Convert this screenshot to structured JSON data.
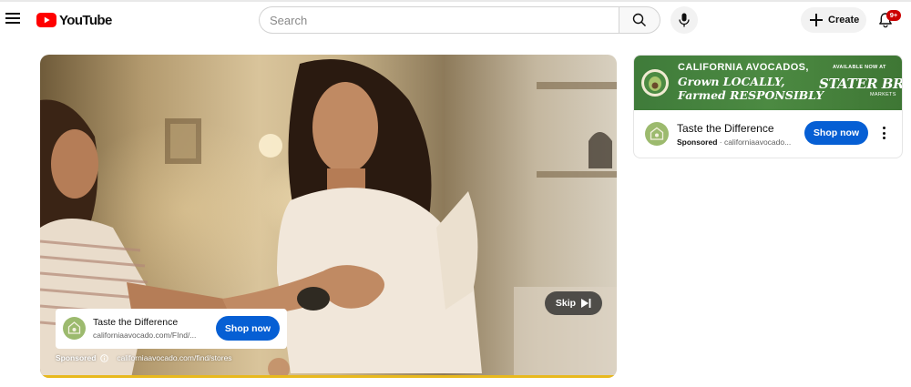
{
  "header": {
    "logo_text": "YouTube",
    "search": {
      "placeholder": "Search",
      "value": ""
    },
    "create_label": "Create",
    "notification_badge": "9+",
    "icons": [
      "menu-icon",
      "youtube-logo-icon",
      "search-icon",
      "mic-icon",
      "plus-icon",
      "bell-icon"
    ]
  },
  "video_ad": {
    "card": {
      "title": "Taste the Difference",
      "url": "californiaavocado.com/FInd/...",
      "cta": "Shop now"
    },
    "sponsored_label": "Sponsored",
    "sponsored_url": "californiaavocado.com/find/stores",
    "skip_label": "Skip",
    "progress_color": "#e8b91e"
  },
  "side_ad": {
    "banner": {
      "line1": "CALIFORNIA AVOCADOS,",
      "line2": "Grown LOCALLY,",
      "line3": "Farmed RESPONSIBLY",
      "available": "AVAILABLE NOW AT",
      "store": "STATER BROS.",
      "store_sub": "MARKETS"
    },
    "title": "Taste the Difference",
    "sponsored": "Sponsored",
    "domain": " · californiaavocado...",
    "cta": "Shop now"
  },
  "colors": {
    "brand_red": "#ff0000",
    "cta_blue": "#065fd4",
    "banner_green": "#4c8a42"
  }
}
